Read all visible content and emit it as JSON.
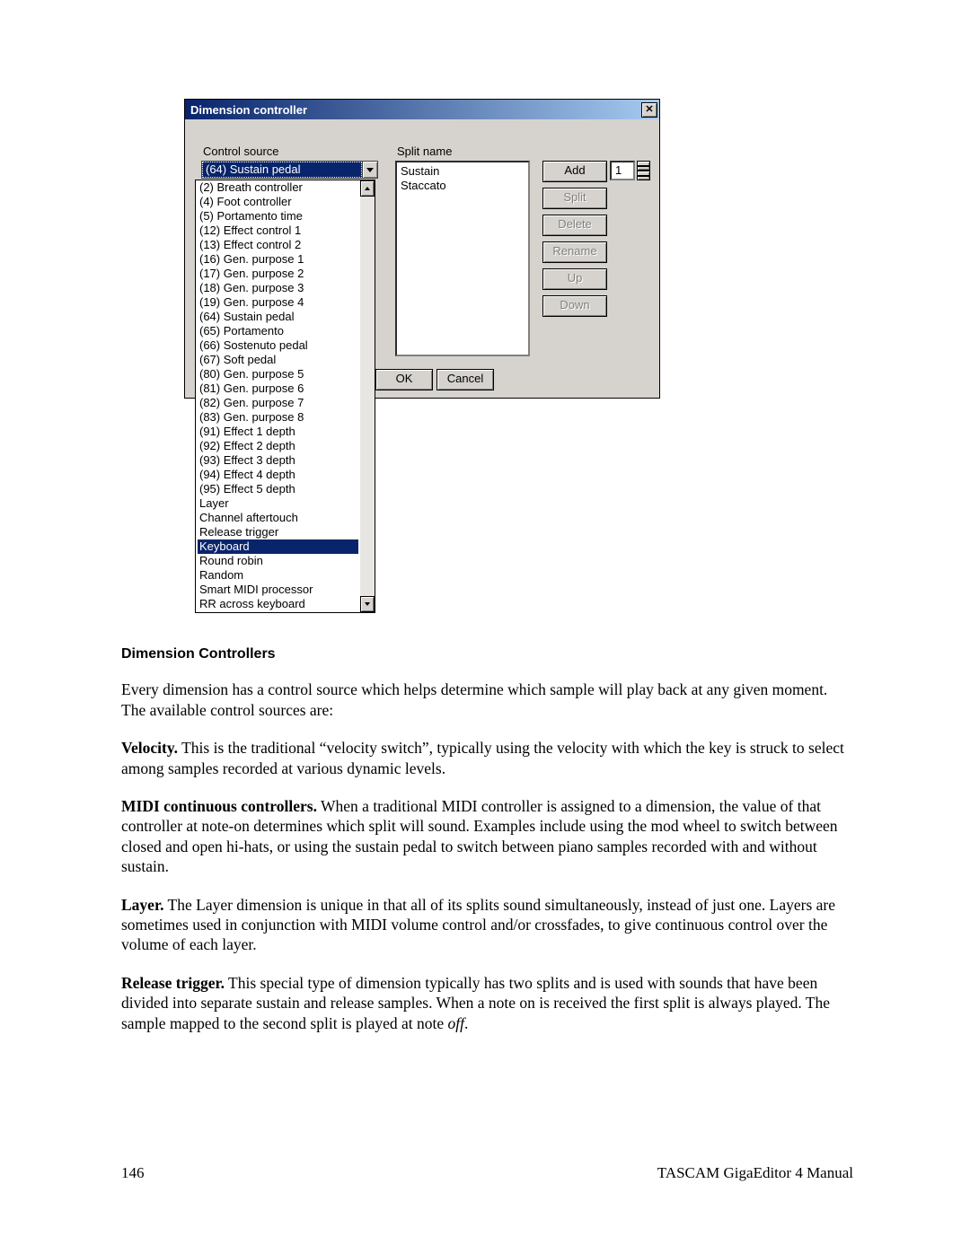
{
  "dialog": {
    "title": "Dimension controller",
    "close_glyph": "✕",
    "control_source_label": "Control source",
    "control_source_value": "(64) Sustain pedal",
    "split_name_label": "Split name",
    "split_items": [
      "Sustain",
      "Staccato"
    ],
    "buttons": {
      "add": "Add",
      "split": "Split",
      "delete": "Delete",
      "rename": "Rename",
      "up": "Up",
      "down": "Down",
      "ok": "OK",
      "cancel": "Cancel"
    },
    "spin_value": "1",
    "dropdown_items": [
      "(2) Breath controller",
      "(4) Foot controller",
      "(5) Portamento time",
      "(12) Effect control 1",
      "(13) Effect control 2",
      "(16) Gen. purpose 1",
      "(17) Gen. purpose 2",
      "(18) Gen. purpose 3",
      "(19) Gen. purpose 4",
      "(64) Sustain pedal",
      "(65) Portamento",
      "(66) Sostenuto pedal",
      "(67) Soft pedal",
      "(80) Gen. purpose 5",
      "(81) Gen. purpose 6",
      "(82) Gen. purpose 7",
      "(83) Gen. purpose 8",
      "(91) Effect 1 depth",
      "(92) Effect 2 depth",
      "(93) Effect 3 depth",
      "(94) Effect 4 depth",
      "(95) Effect 5 depth",
      "Layer",
      "Channel aftertouch",
      "Release trigger",
      "Keyboard",
      "Round robin",
      "Random",
      "Smart MIDI processor",
      "RR across keyboard"
    ],
    "dropdown_selected_index": 25
  },
  "article": {
    "heading": "Dimension Controllers",
    "p_intro": "Every dimension has a control source which helps determine which sample will play back at any given moment.  The available control sources are:",
    "velocity_head": "Velocity.",
    "velocity_body": "  This is the traditional “velocity switch”, typically using the velocity with which the key is struck to select among samples recorded at various dynamic levels.",
    "midi_head": "MIDI continuous controllers.",
    "midi_body": "  When a traditional MIDI controller is assigned to a dimension, the value of that controller at note-on determines which split will sound.  Examples include using the mod wheel to switch between closed and open hi-hats, or using the sustain pedal to switch between piano samples recorded with and without sustain.",
    "layer_head": "Layer.",
    "layer_body": "  The Layer dimension is unique in that all of its splits sound simultaneously, instead of just one.  Layers are sometimes used in conjunction with MIDI volume control and/or crossfades, to give continuous control over the volume of each layer.",
    "release_head": "Release trigger.",
    "release_body_a": "  This special type of dimension typically has two splits and is used with sounds that have been divided into separate sustain and release samples.  When a note on is received the first split is always played.  The sample mapped to the second split is played at note ",
    "release_em": "off",
    "release_body_b": "."
  },
  "footer": {
    "page": "146",
    "manual": "TASCAM GigaEditor 4 Manual"
  }
}
